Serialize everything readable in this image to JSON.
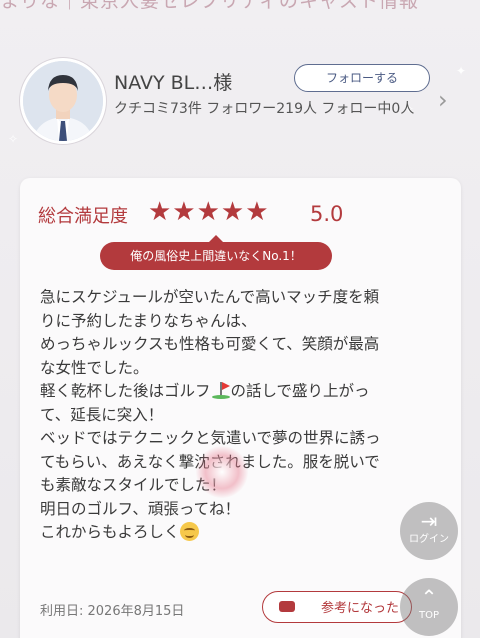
{
  "banner": {
    "text": "まりな｜東京人妻セレブリティのキャスト情報"
  },
  "reviewer": {
    "name": "NAVY BL…様",
    "follow_label": "フォローする",
    "stats": "クチコミ73件 フォロワー219人 フォロー中0人"
  },
  "review": {
    "rating_label": "総合満足度",
    "stars": "★★★★★",
    "score": "5.0",
    "headline": "俺の風俗史上間違いなくNo.1！",
    "lines": [
      "急にスケジュールが空いたんで高いマッチ度を頼",
      "りに予約したまりなちゃんは、",
      "めっちゃルックスも性格も可愛くて、笑顔が最高",
      "な女性でした。",
      "軽く乾杯した後はゴルフ",
      "の話しで盛り上がっ",
      "て、延長に突入！",
      "ベッドではテクニックと気遣いで夢の世界に誘っ",
      "てもらい、あえなく撃沈されました。服を脱いで",
      "も素敵なスタイルでした！",
      "明日のゴルフ、頑張ってね！",
      "これからもよろしく"
    ],
    "use_date": "利用日: 2026年8月15日",
    "helpful_label": "参考になった"
  },
  "floating": {
    "login_label": "ログイン",
    "top_label": "TOP"
  },
  "icons": {
    "flag": "golf-flag-icon",
    "smiley": "smiley-icon",
    "login": "login-icon",
    "top": "arrow-up-icon",
    "hand": "thumbs-up-icon",
    "chevron": "chevron-right-icon"
  },
  "colors": {
    "accent": "#b33a3d",
    "follow": "#4a5a83"
  }
}
